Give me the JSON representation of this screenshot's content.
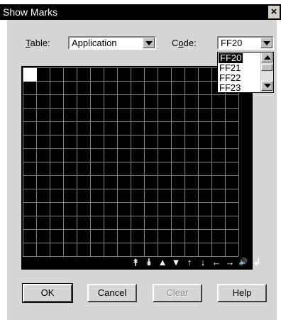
{
  "window": {
    "title": "Show Marks",
    "close_glyph": "×"
  },
  "table": {
    "label": "Table:",
    "value": "Application"
  },
  "code": {
    "label": "Code:",
    "value": "FF20",
    "options": [
      "FF20",
      "FF21",
      "FF22",
      "FF23"
    ],
    "selected_index": 0
  },
  "marks_grid": {
    "columns": 16,
    "rows": 14,
    "glyphs": [
      "⯭",
      "⯯",
      "▲",
      "▼",
      "↑",
      "↓",
      "←",
      "→",
      "🔊",
      "↲"
    ]
  },
  "buttons": {
    "ok": "OK",
    "cancel": "Cancel",
    "clear": "Clear",
    "help": "Help"
  },
  "colors": {
    "title_bar": "#000000",
    "client": "#d6d6d6",
    "grid_bg": "#000000",
    "grid_lines": "#808080",
    "selection": "#000000"
  }
}
